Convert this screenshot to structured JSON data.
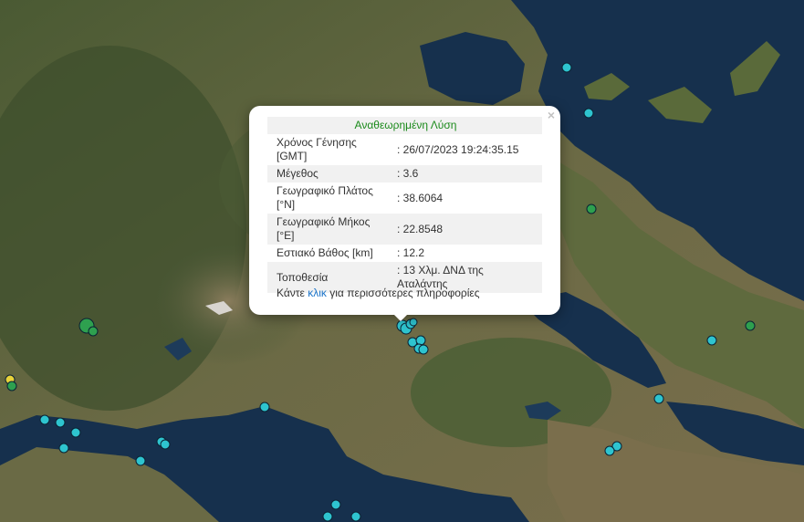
{
  "popup": {
    "close_symbol": "×",
    "heading": "Αναθεωρημένη Λύση",
    "rows": [
      {
        "label": "Χρόνος Γένησης [GMT]",
        "value": ": 26/07/2023 19:24:35.15"
      },
      {
        "label": "Μέγεθος",
        "value": ": 3.6"
      },
      {
        "label": "Γεωγραφικό Πλάτος [°N]",
        "value": ": 38.6064"
      },
      {
        "label": "Γεωγραφικό Μήκος [°E]",
        "value": ": 22.8548"
      },
      {
        "label": "Εστιακό Βάθος [km]",
        "value": ": 12.2"
      },
      {
        "label": "Τοποθεσία",
        "value": ": 13 Χλμ. ΔΝΔ της Αταλάντης"
      }
    ],
    "footer_prefix": "Κάντε",
    "footer_link": "κλικ",
    "footer_suffix": "για περισσότερες πληροφορίες"
  },
  "colors": {
    "marker_cyan": "#2ec4cf",
    "marker_green": "#2ea04f",
    "marker_yellow": "#e8d23a",
    "heading_green": "#1a8a1a",
    "link_blue": "#1a73c9",
    "sea": "#16304d"
  },
  "markers": [
    {
      "kind": "cyan"
    },
    {
      "kind": "cyan"
    },
    {
      "kind": "green"
    },
    {
      "kind": "green"
    },
    {
      "kind": "cyan"
    },
    {
      "kind": "cyan"
    },
    {
      "kind": "cyan"
    },
    {
      "kind": "cyan"
    },
    {
      "kind": "cyan"
    },
    {
      "kind": "cyan"
    },
    {
      "kind": "cyan"
    },
    {
      "kind": "cyan"
    },
    {
      "kind": "cyan"
    },
    {
      "kind": "cyan"
    },
    {
      "kind": "cyan"
    },
    {
      "kind": "green"
    },
    {
      "kind": "yellow"
    },
    {
      "kind": "green"
    },
    {
      "kind": "cyan"
    },
    {
      "kind": "cyan"
    },
    {
      "kind": "cyan"
    },
    {
      "kind": "cyan"
    },
    {
      "kind": "cyan"
    },
    {
      "kind": "cyan"
    },
    {
      "kind": "cyan"
    },
    {
      "kind": "cyan"
    },
    {
      "kind": "cyan"
    },
    {
      "kind": "cyan"
    },
    {
      "kind": "cyan"
    },
    {
      "kind": "green"
    },
    {
      "kind": "cyan"
    },
    {
      "kind": "cyan"
    }
  ]
}
